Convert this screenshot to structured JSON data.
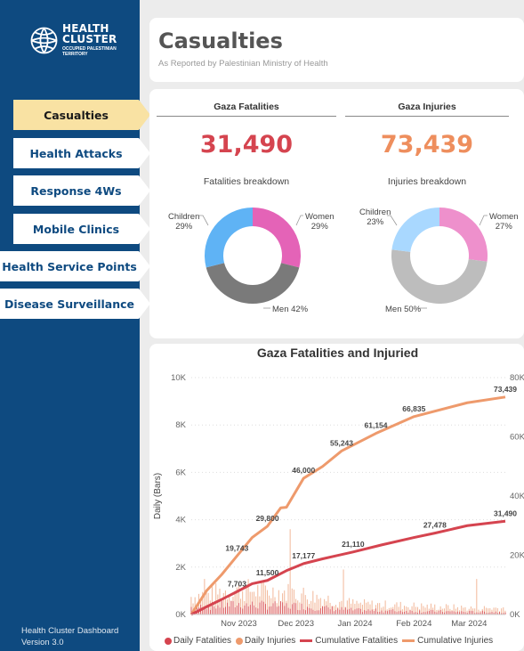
{
  "logo": {
    "line1": "HEALTH",
    "line2": "CLUSTER",
    "line3": "OCCUPIED PALESTINIAN TERRITORY"
  },
  "nav": [
    "Casualties",
    "Health Attacks",
    "Response 4Ws",
    "Mobile Clinics",
    "Health Service Points",
    "Disease Surveillance"
  ],
  "footer": {
    "line1": "Health Cluster Dashboard",
    "line2": "Version 3.0"
  },
  "header": {
    "title": "Casualties",
    "subtitle": "As Reported by Palestinian Ministry of Health"
  },
  "colors": {
    "sidebar": "#0e4a80",
    "active_nav": "#f9e2a3",
    "fatalities": "#d5444f",
    "injuries": "#ee8e5d",
    "children": "#5fb3f5",
    "women": "#e463b7",
    "men": "#7a7a7a",
    "men_inj": "#bdbdbd",
    "children_inj": "#a9d8ff",
    "women_inj": "#ee90cc"
  },
  "fatalities": {
    "header": "Gaza Fatalities",
    "total": "31,490",
    "breakdown_title": "Fatalities breakdown",
    "labels": {
      "children": "Children",
      "children_pct": "29%",
      "women": "Women",
      "women_pct": "29%",
      "men": "Men 42%"
    },
    "slices": [
      29,
      42,
      29
    ]
  },
  "injuries": {
    "header": "Gaza Injuries",
    "total": "73,439",
    "breakdown_title": "Injuries breakdown",
    "labels": {
      "children": "Children",
      "children_pct": "23%",
      "women": "Women",
      "women_pct": "27%",
      "men": "Men 50%"
    },
    "slices": [
      27,
      50,
      23
    ]
  },
  "chart_data": {
    "type": "bar",
    "title": "Gaza Fatalities and Injuried",
    "ylabel": "Daily (Bars)",
    "ylim": [
      0,
      10000
    ],
    "y2lim": [
      0,
      80000
    ],
    "y_ticks": [
      "0K",
      "2K",
      "4K",
      "6K",
      "8K",
      "10K"
    ],
    "y2_ticks": [
      "0K",
      "20K",
      "40K",
      "60K",
      "80K"
    ],
    "x_ticks": [
      "Nov 2023",
      "Dec 2023",
      "Jan 2024",
      "Feb 2024",
      "Mar 2024"
    ],
    "x_tick_dates": [
      "2023-11-01",
      "2023-12-01",
      "2024-01-01",
      "2024-02-01",
      "2024-03-01"
    ],
    "x_range": [
      "2023-10-07",
      "2024-03-20"
    ],
    "legend": [
      "Daily Fatalities",
      "Daily Injuries",
      "Cumulative Fatalities",
      "Cumulative Injuries"
    ],
    "cumulative_fatalities": [
      [
        "2023-10-07",
        0
      ],
      [
        "2023-10-15",
        2600
      ],
      [
        "2023-10-23",
        5100
      ],
      [
        "2023-10-31",
        7703
      ],
      [
        "2023-11-08",
        10400
      ],
      [
        "2023-11-16",
        11500
      ],
      [
        "2023-11-26",
        14800
      ],
      [
        "2023-12-05",
        17177
      ],
      [
        "2023-12-15",
        18800
      ],
      [
        "2023-12-31",
        21110
      ],
      [
        "2024-01-15",
        23500
      ],
      [
        "2024-02-01",
        26000
      ],
      [
        "2024-02-12",
        27478
      ],
      [
        "2024-02-29",
        30000
      ],
      [
        "2024-03-20",
        31490
      ]
    ],
    "cumulative_injuries": [
      [
        "2023-10-07",
        0
      ],
      [
        "2023-10-15",
        8000
      ],
      [
        "2023-10-23",
        13500
      ],
      [
        "2023-10-31",
        19743
      ],
      [
        "2023-11-08",
        26000
      ],
      [
        "2023-11-16",
        29800
      ],
      [
        "2023-11-23",
        36000
      ],
      [
        "2023-11-26",
        36200
      ],
      [
        "2023-12-05",
        46000
      ],
      [
        "2023-12-15",
        50000
      ],
      [
        "2023-12-25",
        55243
      ],
      [
        "2024-01-12",
        61154
      ],
      [
        "2024-02-01",
        66835
      ],
      [
        "2024-02-29",
        71500
      ],
      [
        "2024-03-20",
        73439
      ]
    ],
    "data_labels": [
      {
        "text": "7,703",
        "date": "2023-10-31",
        "value": 7703,
        "series": "fatalities"
      },
      {
        "text": "11,500",
        "date": "2023-11-16",
        "value": 11500,
        "series": "fatalities"
      },
      {
        "text": "17,177",
        "date": "2023-12-05",
        "value": 17177,
        "series": "fatalities"
      },
      {
        "text": "21,110",
        "date": "2023-12-31",
        "value": 21110,
        "series": "fatalities"
      },
      {
        "text": "27,478",
        "date": "2024-02-12",
        "value": 27478,
        "series": "fatalities"
      },
      {
        "text": "31,490",
        "date": "2024-03-20",
        "value": 31490,
        "series": "fatalities"
      },
      {
        "text": "19,743",
        "date": "2023-10-31",
        "value": 19743,
        "series": "injuries"
      },
      {
        "text": "29,800",
        "date": "2023-11-16",
        "value": 29800,
        "series": "injuries"
      },
      {
        "text": "46,000",
        "date": "2023-12-05",
        "value": 46000,
        "series": "injuries"
      },
      {
        "text": "55,243",
        "date": "2023-12-25",
        "value": 55243,
        "series": "injuries"
      },
      {
        "text": "61,154",
        "date": "2024-01-12",
        "value": 61154,
        "series": "injuries"
      },
      {
        "text": "66,835",
        "date": "2024-02-01",
        "value": 66835,
        "series": "injuries"
      },
      {
        "text": "73,439",
        "date": "2024-03-20",
        "value": 73439,
        "series": "injuries"
      }
    ],
    "daily_fatalities_note_values": [
      [
        "2023-10-07",
        250
      ],
      [
        "2023-11-01",
        350
      ],
      [
        "2023-12-01",
        300
      ],
      [
        "2024-01-01",
        150
      ],
      [
        "2024-02-01",
        120
      ],
      [
        "2024-03-01",
        90
      ]
    ],
    "daily_injuries_peaks": [
      [
        "2023-10-14",
        1500
      ],
      [
        "2023-11-28",
        3600
      ],
      [
        "2023-12-26",
        1900
      ],
      [
        "2024-03-05",
        1500
      ]
    ]
  }
}
